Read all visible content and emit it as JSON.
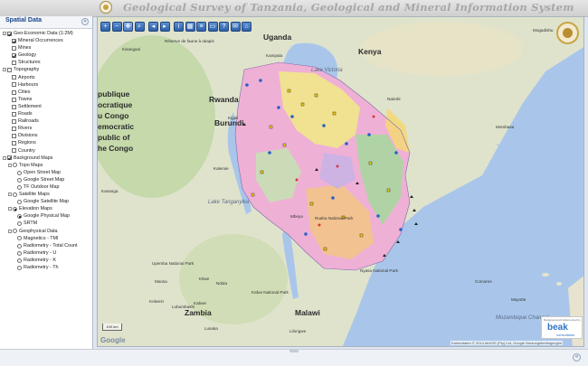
{
  "header": {
    "title": "Geological Survey of Tanzania, Geological and Mineral Information System"
  },
  "sidebar": {
    "title": "Spatial Data",
    "collapse_glyph": "«",
    "tree": [
      {
        "label": "Geo-Economic Data (1:2M)",
        "level": 0,
        "type": "checkbox",
        "checked": true,
        "expander": "minus"
      },
      {
        "label": "Mineral Occurrences",
        "level": 1,
        "type": "checkbox",
        "checked": true
      },
      {
        "label": "Mines",
        "level": 1,
        "type": "checkbox",
        "checked": false
      },
      {
        "label": "Geology",
        "level": 1,
        "type": "checkbox",
        "checked": true
      },
      {
        "label": "Structures",
        "level": 1,
        "type": "checkbox",
        "checked": false
      },
      {
        "label": "Topography",
        "level": 0,
        "type": "checkbox",
        "checked": false,
        "expander": "minus"
      },
      {
        "label": "Airports",
        "level": 1,
        "type": "checkbox",
        "checked": false
      },
      {
        "label": "Harbours",
        "level": 1,
        "type": "checkbox",
        "checked": false
      },
      {
        "label": "Cities",
        "level": 1,
        "type": "checkbox",
        "checked": false
      },
      {
        "label": "Towns",
        "level": 1,
        "type": "checkbox",
        "checked": false
      },
      {
        "label": "Settlement",
        "level": 1,
        "type": "checkbox",
        "checked": false
      },
      {
        "label": "Roads",
        "level": 1,
        "type": "checkbox",
        "checked": false
      },
      {
        "label": "Railroads",
        "level": 1,
        "type": "checkbox",
        "checked": false
      },
      {
        "label": "Rivers",
        "level": 1,
        "type": "checkbox",
        "checked": false
      },
      {
        "label": "Divisions",
        "level": 1,
        "type": "checkbox",
        "checked": false
      },
      {
        "label": "Regions",
        "level": 1,
        "type": "checkbox",
        "checked": false
      },
      {
        "label": "Country",
        "level": 1,
        "type": "checkbox",
        "checked": false
      },
      {
        "label": "Background Maps",
        "level": 0,
        "type": "checkbox",
        "checked": true,
        "expander": "minus"
      },
      {
        "label": "Topo Maps",
        "level": 1,
        "type": "radio",
        "checked": false,
        "expander": "minus"
      },
      {
        "label": "Open Street Map",
        "level": 2,
        "type": "radio",
        "checked": false
      },
      {
        "label": "Google Street Map",
        "level": 2,
        "type": "radio",
        "checked": false
      },
      {
        "label": "TF Outdoor Map",
        "level": 2,
        "type": "radio",
        "checked": false
      },
      {
        "label": "Satellite Maps",
        "level": 1,
        "type": "radio",
        "checked": false,
        "expander": "minus"
      },
      {
        "label": "Google Satellite Map",
        "level": 2,
        "type": "radio",
        "checked": false
      },
      {
        "label": "Elevation Maps",
        "level": 1,
        "type": "radio",
        "checked": true,
        "expander": "minus"
      },
      {
        "label": "Google Physical Map",
        "level": 2,
        "type": "radio",
        "checked": true
      },
      {
        "label": "SRTM",
        "level": 2,
        "type": "radio",
        "checked": false
      },
      {
        "label": "Geophysical Data",
        "level": 1,
        "type": "radio",
        "checked": false,
        "expander": "minus"
      },
      {
        "label": "Magnetics - TMI",
        "level": 2,
        "type": "radio",
        "checked": false
      },
      {
        "label": "Radiometry - Total Count",
        "level": 2,
        "type": "radio",
        "checked": false
      },
      {
        "label": "Radiometry - U",
        "level": 2,
        "type": "radio",
        "checked": false
      },
      {
        "label": "Radiometry - K",
        "level": 2,
        "type": "radio",
        "checked": false
      },
      {
        "label": "Radiometry - Th",
        "level": 2,
        "type": "radio",
        "checked": false
      }
    ]
  },
  "toolbar": {
    "buttons": [
      {
        "name": "zoom-in-button",
        "icon": "plus-icon",
        "glyph": "+",
        "gap": false,
        "selected": false
      },
      {
        "name": "zoom-out-button",
        "icon": "minus-icon",
        "glyph": "−",
        "gap": false,
        "selected": false
      },
      {
        "name": "pan-button",
        "icon": "move-icon",
        "glyph": "✥",
        "gap": false,
        "selected": true
      },
      {
        "name": "zoom-box-button",
        "icon": "magnifier-icon",
        "glyph": "⌕",
        "gap": false,
        "selected": false
      },
      {
        "name": "previous-extent-button",
        "icon": "arrow-left-icon",
        "glyph": "◂",
        "gap": true,
        "selected": false
      },
      {
        "name": "next-extent-button",
        "icon": "arrow-right-icon",
        "glyph": "▸",
        "gap": false,
        "selected": false
      },
      {
        "name": "identify-button",
        "icon": "info-icon",
        "glyph": "i",
        "gap": true,
        "selected": false
      },
      {
        "name": "measure-button",
        "icon": "ruler-icon",
        "glyph": "▦",
        "gap": false,
        "selected": false
      },
      {
        "name": "layers-button",
        "icon": "layers-icon",
        "glyph": "≡",
        "gap": false,
        "selected": false
      },
      {
        "name": "print-button",
        "icon": "print-icon",
        "glyph": "▭",
        "gap": false,
        "selected": false
      },
      {
        "name": "help-button",
        "icon": "help-icon",
        "glyph": "?",
        "gap": false,
        "selected": false
      },
      {
        "name": "email-button",
        "icon": "mail-icon",
        "glyph": "✉",
        "gap": false,
        "selected": false
      },
      {
        "name": "home-button",
        "icon": "home-icon",
        "glyph": "⌂",
        "gap": false,
        "selected": false
      }
    ]
  },
  "map": {
    "labels": [
      {
        "text": "Uganda",
        "kind": "country"
      },
      {
        "text": "Kenya",
        "kind": "country"
      },
      {
        "text": "Rwanda",
        "kind": "country"
      },
      {
        "text": "Burundi",
        "kind": "country"
      },
      {
        "text": "publique",
        "kind": "country"
      },
      {
        "text": "ocratique",
        "kind": "country"
      },
      {
        "text": "u Congo",
        "kind": "country"
      },
      {
        "text": "emocratic",
        "kind": "country"
      },
      {
        "text": "public of",
        "kind": "country"
      },
      {
        "text": "he Congo",
        "kind": "country"
      },
      {
        "text": "Zambia",
        "kind": "country"
      },
      {
        "text": "Malawi",
        "kind": "country"
      },
      {
        "text": "Mogadishu",
        "kind": "city"
      },
      {
        "text": "Kampala",
        "kind": "city"
      },
      {
        "text": "Kisangani",
        "kind": "city"
      },
      {
        "text": "Nairobi",
        "kind": "city"
      },
      {
        "text": "Mombasa",
        "kind": "city"
      },
      {
        "text": "Kigali",
        "kind": "city"
      },
      {
        "text": "Kalemie",
        "kind": "city"
      },
      {
        "text": "Lubumbashi",
        "kind": "city"
      },
      {
        "text": "Lilongwe",
        "kind": "city"
      },
      {
        "text": "Mayotte",
        "kind": "city"
      },
      {
        "text": "Comores",
        "kind": "city"
      },
      {
        "text": "Kananga",
        "kind": "city"
      },
      {
        "text": "Mbeya",
        "kind": "city"
      },
      {
        "text": "Ndola",
        "kind": "city"
      },
      {
        "text": "Kitwe",
        "kind": "city"
      },
      {
        "text": "Kabwe",
        "kind": "city"
      },
      {
        "text": "Lusaka",
        "kind": "city"
      },
      {
        "text": "Mansa",
        "kind": "city"
      },
      {
        "text": "Kolwezi",
        "kind": "city"
      },
      {
        "text": "Réserve de faune à okapis",
        "kind": "city"
      },
      {
        "text": "Lake Victoria",
        "kind": "sea"
      },
      {
        "text": "Nyasa National Park",
        "kind": "city"
      },
      {
        "text": "Kafue National Park",
        "kind": "city"
      },
      {
        "text": "Ruaha National Park",
        "kind": "city"
      },
      {
        "text": "Upemba National Park",
        "kind": "city"
      },
      {
        "text": "Lake Tanganyika",
        "kind": "sea"
      },
      {
        "text": "Mozambique Channel",
        "kind": "sea"
      }
    ],
    "scale_label": "100 km",
    "google_logo": "Google",
    "attribution": "Kartendaten © 2014 AfriGIS (Pty) Ltd, Google   Nutzungsbedingungen",
    "colors": {
      "water": "#a9c6ea",
      "land": "#dfe3cc",
      "geology_pink": "#efb0d6",
      "geology_yellow": "#efe88a",
      "geology_green": "#a8d7a0",
      "geology_orange": "#f2c48a"
    }
  },
  "sponsor": {
    "caption": "Designed and Implemented by",
    "name": "beak",
    "sub": "consultants"
  },
  "status": {
    "collapse_glyph": "«"
  }
}
